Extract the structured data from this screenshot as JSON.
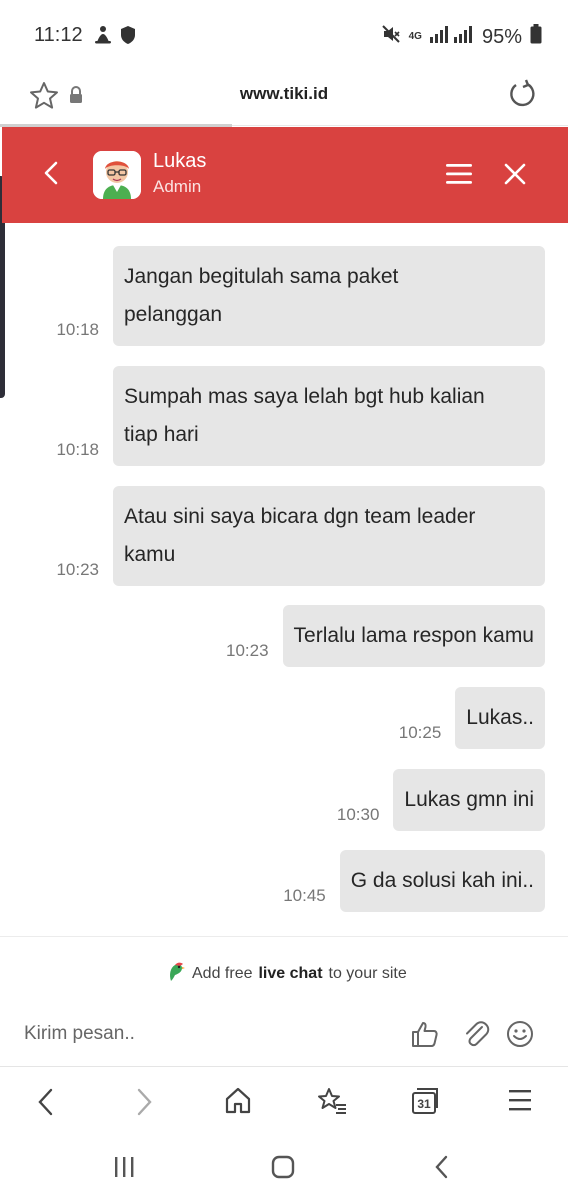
{
  "status_bar": {
    "time": "11:12",
    "network": "4G",
    "battery": "95%",
    "icons": [
      "meditation-icon",
      "shield-icon",
      "mute-icon",
      "signal-icon",
      "battery-icon"
    ]
  },
  "browser": {
    "url": "www.tiki.id",
    "icons": [
      "star-icon",
      "lock-icon",
      "reload-icon"
    ]
  },
  "chat_header": {
    "name": "Lukas",
    "role": "Admin",
    "bg_color": "#d94240",
    "icons": [
      "back-icon",
      "avatar",
      "menu-icon",
      "close-icon"
    ]
  },
  "messages": [
    {
      "time": "10:18",
      "lines": [
        "Jangan begitulah sama paket",
        "pelanggan"
      ]
    },
    {
      "time": "10:18",
      "lines": [
        "Sumpah mas saya lelah bgt hub kalian",
        "tiap hari"
      ]
    },
    {
      "time": "10:23",
      "lines": [
        "Atau sini saya bicara dgn team leader",
        "kamu"
      ]
    },
    {
      "time": "10:23",
      "lines": [
        "Terlalu lama respon kamu"
      ]
    },
    {
      "time": "10:25",
      "lines": [
        "Lukas.."
      ]
    },
    {
      "time": "10:30",
      "lines": [
        "Lukas gmn ini"
      ]
    },
    {
      "time": "10:45",
      "lines": [
        "G da solusi kah ini.."
      ]
    }
  ],
  "branding": {
    "prefix": "Add free",
    "bold": "live chat",
    "suffix": "to your site"
  },
  "composer": {
    "placeholder": "Kirim pesan..",
    "icons": [
      "thumbs-up-icon",
      "paperclip-icon",
      "emoji-icon"
    ]
  },
  "browser_nav": {
    "tabs_count": "31",
    "icons": [
      "back-arrow-icon",
      "forward-arrow-icon",
      "home-icon",
      "bookmarks-icon",
      "tabs-icon",
      "menu-icon"
    ]
  },
  "system_nav": {
    "icons": [
      "recents-icon",
      "home-button-icon",
      "back-icon"
    ]
  }
}
